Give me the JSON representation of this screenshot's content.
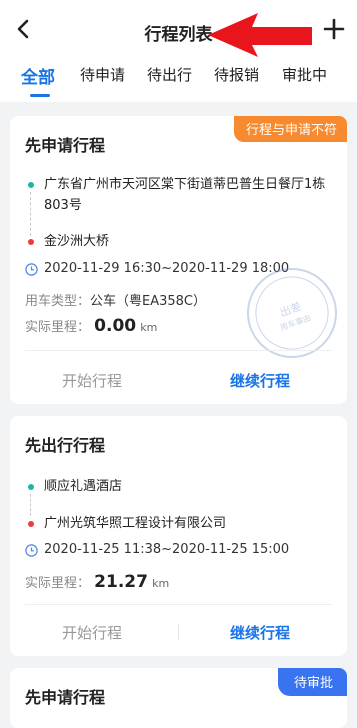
{
  "header": {
    "title": "行程列表"
  },
  "tabs": [
    {
      "label": "全部",
      "active": true
    },
    {
      "label": "待申请",
      "active": false
    },
    {
      "label": "待出行",
      "active": false
    },
    {
      "label": "待报销",
      "active": false
    },
    {
      "label": "审批中",
      "active": false
    }
  ],
  "cards": [
    {
      "title": "先申请行程",
      "badge": "行程与申请不符",
      "from": "广东省广州市天河区棠下街道蒂巴普生日餐厅1栋803号",
      "to": "金沙洲大桥",
      "time": "2020-11-29 16:30~2020-11-29 18:00",
      "vehicle_label": "用车类型：",
      "vehicle_value": "公车（粤EA358C）",
      "mileage_label": "实际里程：",
      "mileage_value": "0.00",
      "mileage_unit": "km",
      "stamp_text": [
        "出差",
        "用车事由"
      ],
      "start_btn": "开始行程",
      "continue_btn": "继续行程"
    },
    {
      "title": "先出行行程",
      "from": "顺应礼遇酒店",
      "to": "广州光筑华照工程设计有限公司",
      "time": "2020-11-25 11:38~2020-11-25 15:00",
      "mileage_label": "实际里程：",
      "mileage_value": "21.27",
      "mileage_unit": "km",
      "start_btn": "开始行程",
      "continue_btn": "继续行程"
    },
    {
      "title": "先申请行程",
      "badge": "待审批"
    }
  ],
  "icons": {
    "back": "chevron-left-icon",
    "add": "plus-icon",
    "clock": "clock-icon",
    "annotation": "red-arrow-annotation"
  },
  "colors": {
    "accent": "#1a74e8",
    "badge_orange": "#f7892f",
    "badge_blue": "#3a73ef",
    "from_dot": "#1bb6a0",
    "to_dot": "#ee3b3b",
    "annotation_arrow": "#e8161c"
  }
}
